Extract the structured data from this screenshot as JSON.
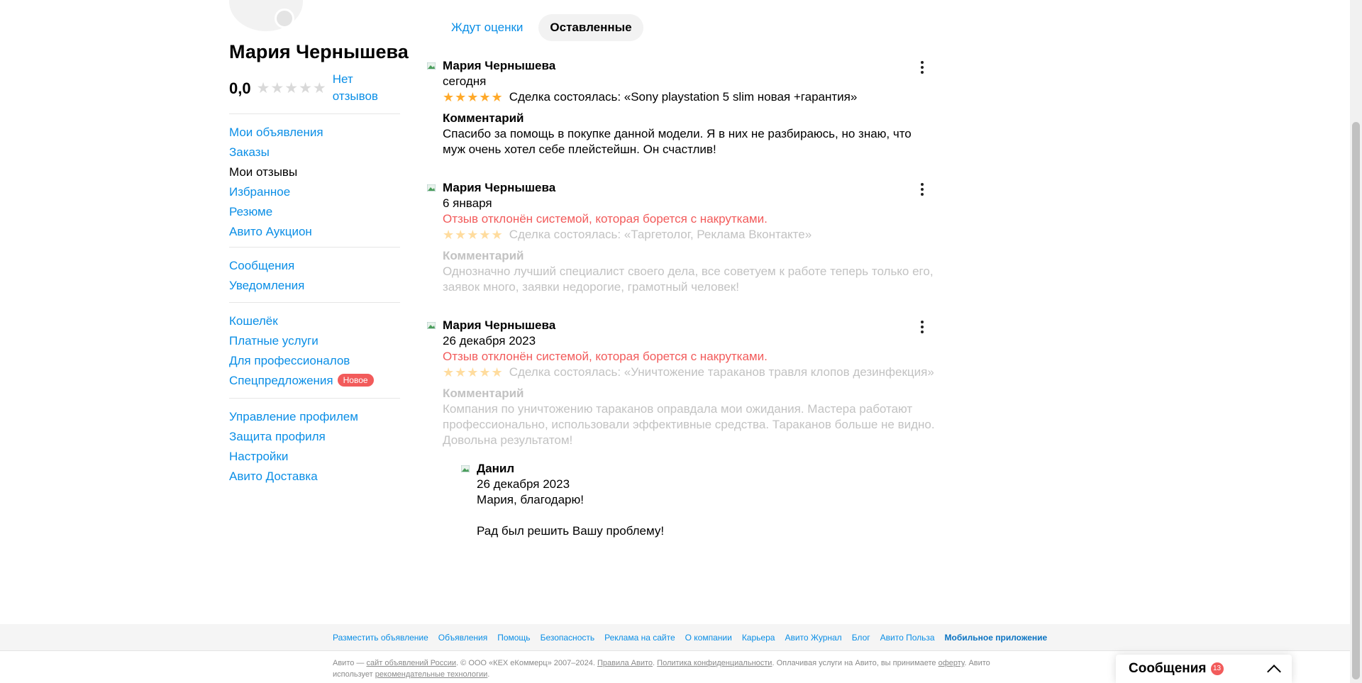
{
  "sidebar": {
    "name": "Мария Чернышева",
    "rating_value": "0,0",
    "rating_stars": "★★★★★",
    "no_reviews": "Нет отзывов",
    "group1": [
      "Мои объявления",
      "Заказы",
      "Мои отзывы",
      "Избранное",
      "Резюме",
      "Авито Аукцион"
    ],
    "group2": [
      "Сообщения",
      "Уведомления"
    ],
    "group3": [
      "Кошелёк",
      "Платные услуги",
      "Для профессионалов",
      "Спецпредложения"
    ],
    "group3_badge": "Новое",
    "group4": [
      "Управление профилем",
      "Защита профиля",
      "Настройки",
      "Авито Доставка"
    ]
  },
  "tabs": {
    "pending": "Ждут оценки",
    "left": "Оставленные"
  },
  "reviews": [
    {
      "author": "Мария Чернышева",
      "date": "сегодня",
      "rejected": "",
      "stars": "★★★★★",
      "deal": "Сделка состоялась: «Sony playstation 5 slim новая +гарантия»",
      "comment_title": "Комментарий",
      "comment": "Спасибо за помощь в покупке данной модели. Я в них не разбираюсь, но знаю, что муж очень хотел себе плейстейшн. Он счастлив!"
    },
    {
      "author": "Мария Чернышева",
      "date": "6 января",
      "rejected": "Отзыв отклонён системой, которая борется с накрутками.",
      "stars": "★★★★★",
      "deal": "Сделка состоялась: «Таргетолог, Реклама Вконтакте»",
      "comment_title": "Комментарий",
      "comment": "Однозначно лучший специалист своего дела, все советуем к работе теперь только его, заявок много, заявки недорогие, грамотный человек!"
    },
    {
      "author": "Мария Чернышева",
      "date": "26 декабря 2023",
      "rejected": "Отзыв отклонён системой, которая борется с накрутками.",
      "stars": "★★★★★",
      "deal": "Сделка состоялась: «Уничтожение тараканов травля клопов дезинфекция»",
      "comment_title": "Комментарий",
      "comment": "Компания по уничтожению тараканов оправдала мои ожидания. Мастера работают профессионально, использовали эффективные средства. Тараканов больше не видно. Довольна результатом!"
    }
  ],
  "reply": {
    "author": "Данил",
    "date": "26 декабря 2023",
    "line1": "Мария, благодарю!",
    "line2": "Рад был решить Вашу проблему!"
  },
  "footer": {
    "links": [
      "Разместить объявление",
      "Объявления",
      "Помощь",
      "Безопасность",
      "Реклама на сайте",
      "О компании",
      "Карьера",
      "Авито Журнал",
      "Блог",
      "Авито Польза",
      "Мобильное приложение"
    ],
    "legal_1": "Авито — ",
    "legal_link1": "сайт объявлений России",
    "legal_2": ". © ООО «КЕХ еКоммерц» 2007–2024. ",
    "legal_link2": "Правила Авито",
    "legal_3": ". ",
    "legal_link3": "Политика конфиденциальности",
    "legal_4": ". Оплачивая услуги на Авито, вы принимаете ",
    "legal_link4": "оферту",
    "legal_5": ". Авито использует ",
    "legal_link5": "рекомендательные технологии",
    "legal_6": "."
  },
  "messages_widget": {
    "label": "Сообщения",
    "count": "13"
  }
}
